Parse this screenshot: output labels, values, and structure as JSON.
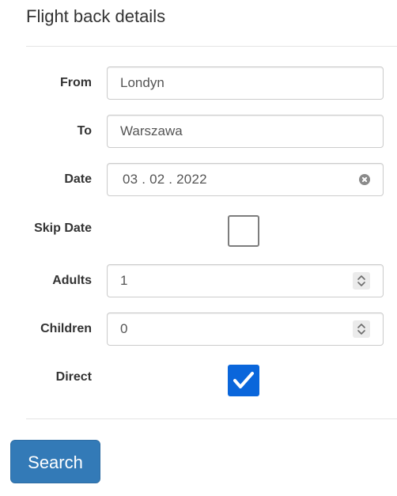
{
  "title": "Flight back details",
  "form": {
    "from": {
      "label": "From",
      "value": "Londyn"
    },
    "to": {
      "label": "To",
      "value": "Warszawa"
    },
    "date": {
      "label": "Date",
      "value": "03 . 02 . 2022"
    },
    "skip_date": {
      "label": "Skip Date",
      "checked": false
    },
    "adults": {
      "label": "Adults",
      "value": "1"
    },
    "children": {
      "label": "Children",
      "value": "0"
    },
    "direct": {
      "label": "Direct",
      "checked": true
    }
  },
  "actions": {
    "search_label": "Search"
  },
  "colors": {
    "primary_button": "#337ab7",
    "checkbox_checked": "#0a66db",
    "label_text": "#333333",
    "input_text": "#555555"
  },
  "icons": {
    "date_clear": "clear-circle-icon",
    "spinner": "up-down-chevron-icon",
    "check": "checkmark-icon"
  }
}
